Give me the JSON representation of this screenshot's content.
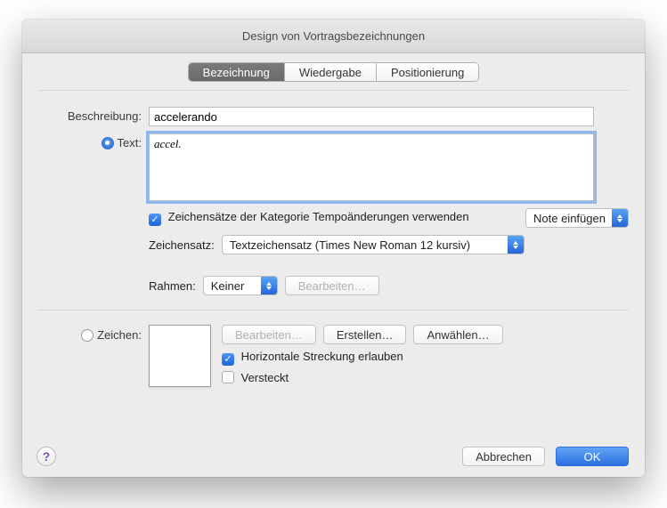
{
  "window": {
    "title": "Design von Vortragsbezeichnungen"
  },
  "tabs": {
    "t0": "Bezeichnung",
    "t1": "Wiedergabe",
    "t2": "Positionierung"
  },
  "labels": {
    "description": "Beschreibung:",
    "text": "Text:",
    "fontset": "Zeichensatz:",
    "frame": "Rahmen:",
    "char": "Zeichen:"
  },
  "fields": {
    "description": "accelerando",
    "text": "accel."
  },
  "checks": {
    "useCategoryFonts": "Zeichensätze der Kategorie Tempoänderungen verwenden",
    "horizStretch": "Horizontale Streckung erlauben",
    "hidden": "Versteckt"
  },
  "popups": {
    "fontset": "Textzeichensatz (Times New Roman 12  kursiv)",
    "frame": "Keiner",
    "insertNote": "Note einfügen"
  },
  "buttons": {
    "editFrame": "Bearbeiten…",
    "editChar": "Bearbeiten…",
    "create": "Erstellen…",
    "select": "Anwählen…",
    "cancel": "Abbrechen",
    "ok": "OK"
  },
  "help": "?"
}
